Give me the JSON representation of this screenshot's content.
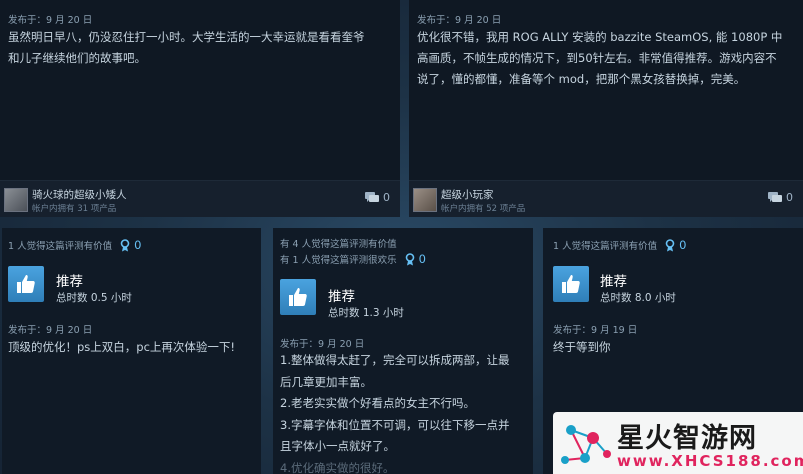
{
  "reviews_top": [
    {
      "posted": "发布于：9 月 20 日",
      "text_lines": [
        "虽然明日早八，仍没忍住打一小时。大学生活的一大幸运就是看看奎爷",
        "和儿子继续他们的故事吧。"
      ],
      "user": "骑火球的超级小矮人",
      "products": "帐户内拥有 31 项产品",
      "comments": "0"
    },
    {
      "posted": "发布于：9 月 20 日",
      "text_lines": [
        "优化很不错，我用 ROG ALLY 安装的 bazzite SteamOS, 能 1080P 中",
        "高画质，不帧生成的情况下，到50针左右。非常值得推荐。游戏内容不",
        "说了，懂的都懂，准备等个 mod，把那个黑女孩替换掉，完美。"
      ],
      "user": "超级小玩家",
      "products": "帐户内拥有 52 项产品",
      "comments": "0"
    }
  ],
  "reviews_bottom": [
    {
      "helpful_lines": [
        "1 人觉得这篇评测有价值"
      ],
      "awards": "0",
      "recommendation": "推荐",
      "hours": "总时数 0.5 小时",
      "posted": "发布于：9 月 20 日",
      "text_lines": [
        "顶级的优化！ps上双白，pc上再次体验一下!"
      ]
    },
    {
      "helpful_lines": [
        "有 4 人觉得这篇评测有价值",
        "有 1 人觉得这篇评测很欢乐"
      ],
      "awards": "0",
      "recommendation": "推荐",
      "hours": "总时数 1.3 小时",
      "posted": "发布于：9 月 20 日",
      "text_lines": [
        "1.整体做得太赶了，完全可以拆成两部，让最",
        "后几章更加丰富。",
        "2.老老实实做个好看点的女主不行吗。",
        "3.字幕字体和位置不可调，可以往下移一点并",
        "且字体小一点就好了。",
        "4.优化确实做的很好。"
      ]
    },
    {
      "helpful_lines": [
        "1 人觉得这篇评测有价值"
      ],
      "awards": "0",
      "recommendation": "推荐",
      "hours": "总时数 8.0 小时",
      "posted": "发布于：9 月 19 日",
      "text_lines": [
        "终于等到你"
      ]
    }
  ],
  "watermark": {
    "title": "星火智游网",
    "url": "www.XHCS188.com"
  },
  "colors": {
    "accent": "#66c0f4",
    "card": "#101a26",
    "text": "#c6d4df",
    "brand_pink": "#e0245e"
  }
}
